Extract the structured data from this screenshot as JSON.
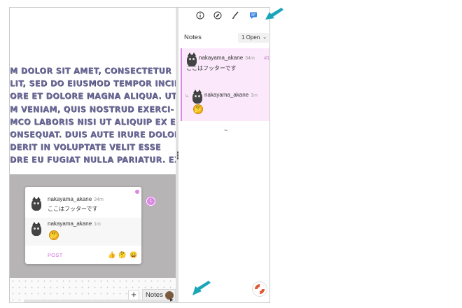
{
  "document": {
    "lines": [
      "M DOLOR SIT AMET, CONSECTETUR",
      "LIT, SED DO EIUSMOD TEMPOR INCID-",
      "ORE ET DOLORE MAGNA ALIQUA. UT",
      "M VENIAM, QUIS NOSTRUD EXERCI-",
      "MCO LABORIS NISI UT ALIQUIP EX EA",
      "ONSEQUAT. DUIS AUTE IRURE DOLOR",
      "DERIT IN VOLUPTATE VELIT ESSE",
      "DRE EU FUGIAT NULLA PARIATUR. EX-"
    ]
  },
  "bottom_bar": {
    "add_label": "+",
    "notes_label": "Notes"
  },
  "popover": {
    "badge": "1",
    "messages": [
      {
        "author": "nakayama_akane",
        "time": "34m",
        "text": "ここはフッターです"
      },
      {
        "author": "nakayama_akane",
        "time": "1m",
        "emoji": "🤔"
      }
    ],
    "post_label": "POST",
    "reactions": [
      "👍",
      "🤔",
      "😄"
    ]
  },
  "toolbar": {
    "icons": [
      "info-icon",
      "compass-icon",
      "brush-icon",
      "comment-icon"
    ],
    "active_color": "#3a86e0"
  },
  "panel": {
    "title": "Notes",
    "filter_label": "1 Open",
    "thread": {
      "number": "#1",
      "messages": [
        {
          "author": "nakayama_akane",
          "time": "34m",
          "text": "ここはフッターです"
        },
        {
          "author": "nakayama_akane",
          "time": "1m",
          "emoji": "🤔"
        }
      ]
    },
    "tilde": "~"
  },
  "colors": {
    "accent": "#d78be0",
    "arrow": "#1aa6b8",
    "doc_text": "#6b6a98"
  }
}
